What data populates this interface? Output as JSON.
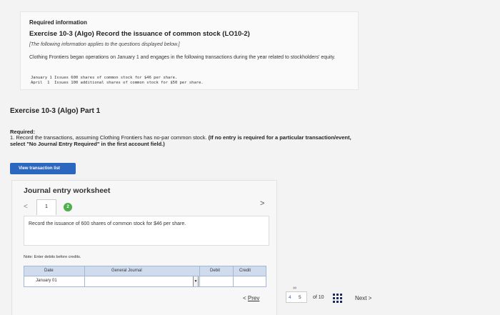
{
  "info": {
    "heading": "Required information",
    "exercise_title": "Exercise 10-3 (Algo) Record the issuance of common stock (LO10-2)",
    "note": "[The following information applies to the questions displayed below.]",
    "description": "Clothing Frontiers began operations on January 1 and engages in the following transactions during the year related to stockholders' equity.",
    "transactions": [
      "January 1 Issues 600 shares of common stock for $46 per share.",
      "April  1  Issues 100 additional shares of common stock for $50 per share."
    ]
  },
  "part_title": "Exercise 10-3 (Algo) Part 1",
  "required": {
    "label": "Required:",
    "text_plain": "1. Record the transactions, assuming Clothing Frontiers has no-par common stock. ",
    "text_bold": "(If no entry is required for a particular transaction/event, select \"No Journal Entry Required\" in the first account field.)"
  },
  "view_button": "View transaction list",
  "worksheet": {
    "title": "Journal entry worksheet",
    "prev": "<",
    "tab1": "1",
    "tab2": "2",
    "next": ">",
    "prompt": "Record the issuance of 600 shares of common stock for $46 per share.",
    "note": "Note: Enter debits before credits.",
    "columns": {
      "date": "Date",
      "journal": "General Journal",
      "debit": "Debit",
      "credit": "Credit"
    },
    "row_date": "January 01"
  },
  "nav": {
    "prev": "Prev",
    "link_icon": "link-icon",
    "page_prev": "4",
    "page_current": "5",
    "of_total": "of 10",
    "next": "Next"
  },
  "colors": {
    "accent_blue": "#2c67bf",
    "tab_green": "#4caf4c",
    "table_header": "#cfdcee"
  }
}
